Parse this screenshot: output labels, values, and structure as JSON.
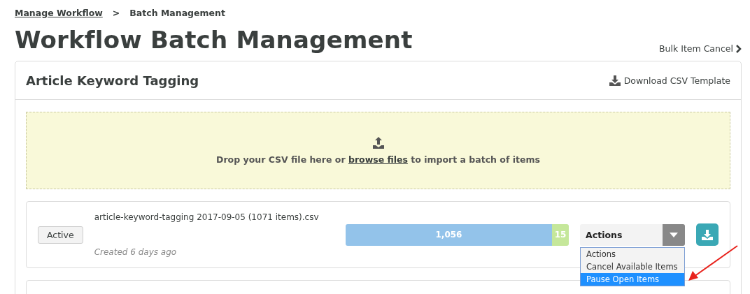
{
  "breadcrumb": [
    {
      "label": "Manage Workflow",
      "kind": "link"
    },
    {
      "label": ">",
      "kind": "text"
    },
    {
      "label": "Batch Management",
      "kind": "text"
    }
  ],
  "page_title": "Workflow Batch Management",
  "bulk_link": "Bulk Item Cancel",
  "card": {
    "title": "Article Keyword Tagging",
    "download_link": "Download CSV Template",
    "dropzone": {
      "before": "Drop your CSV file here or ",
      "link": "browse files",
      "after": " to import a batch of items"
    },
    "batches": [
      {
        "status": "Active",
        "filename": "article-keyword-tagging 2017-09-05 (1071 items).csv",
        "created": "Created 6 days ago",
        "segments": [
          {
            "label": "1,056",
            "color": "#93c3ea"
          },
          {
            "label": "15",
            "color": "#c5e79a"
          }
        ],
        "select": {
          "value": "Actions",
          "options": [
            {
              "label": "Actions",
              "highlighted": false
            },
            {
              "label": "Cancel Available Items",
              "highlighted": false
            },
            {
              "label": "Pause Open Items",
              "highlighted": true
            }
          ]
        }
      }
    ]
  }
}
